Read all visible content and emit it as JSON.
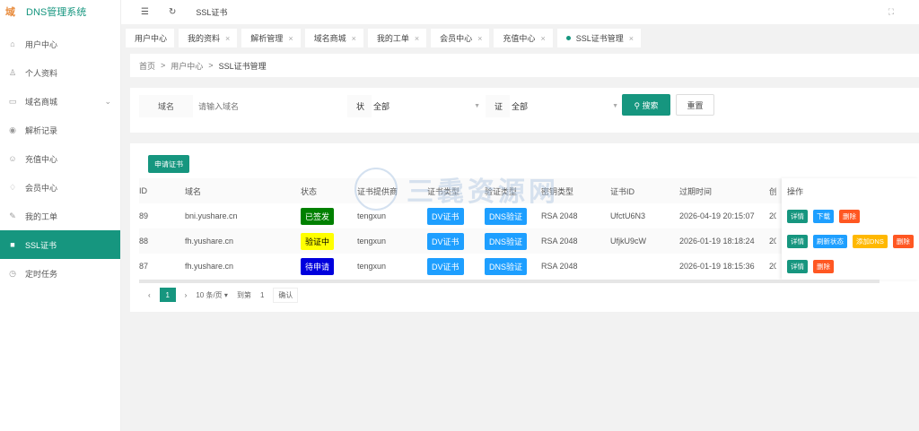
{
  "app": {
    "logo_glyph": "域",
    "title": "DNS管理系统"
  },
  "sidebar": {
    "items": [
      {
        "label": "用户中心",
        "icon": "home-icon",
        "glyph": "⌂"
      },
      {
        "label": "个人资料",
        "icon": "user-icon",
        "glyph": "♙"
      },
      {
        "label": "域名商城",
        "icon": "store-icon",
        "glyph": "▭",
        "has_children": true
      },
      {
        "label": "解析记录",
        "icon": "record-icon",
        "glyph": "◉"
      },
      {
        "label": "充值中心",
        "icon": "recharge-icon",
        "glyph": "☺"
      },
      {
        "label": "会员中心",
        "icon": "diamond-icon",
        "glyph": "♢"
      },
      {
        "label": "我的工单",
        "icon": "ticket-icon",
        "glyph": "✎"
      },
      {
        "label": "SSL证书",
        "icon": "ssl-icon",
        "glyph": "■",
        "active": true
      },
      {
        "label": "定时任务",
        "icon": "clock-icon",
        "glyph": "◷"
      }
    ]
  },
  "topbar": {
    "title": "SSL证书"
  },
  "tabs": [
    {
      "label": "用户中心",
      "closable": false
    },
    {
      "label": "我的资料",
      "closable": true
    },
    {
      "label": "解析管理",
      "closable": true
    },
    {
      "label": "域名商城",
      "closable": true
    },
    {
      "label": "我的工单",
      "closable": true
    },
    {
      "label": "会员中心",
      "closable": true
    },
    {
      "label": "充值中心",
      "closable": true
    },
    {
      "label": "SSL证书管理",
      "closable": true,
      "active": true
    }
  ],
  "breadcrumb": [
    "首页",
    "用户中心",
    "SSL证书管理"
  ],
  "breadcrumb_sep": ">",
  "filter": {
    "domain_label": "域名",
    "domain_placeholder": "请输入域名",
    "status_label": "状",
    "status_value": "全部",
    "type_label": "证",
    "type_value": "全部",
    "search_label": "搜索",
    "reset_label": "重置"
  },
  "table": {
    "apply_label": "申请证书",
    "headers": [
      "ID",
      "域名",
      "状态",
      "证书提供商",
      "证书类型",
      "验证类型",
      "密钥类型",
      "证书ID",
      "过期时间",
      "创",
      "操作"
    ],
    "rows": [
      {
        "id": "89",
        "domain": "bni.yushare.cn",
        "status": "已签发",
        "status_bg": "#008000",
        "status_fg": "#ffffff",
        "provider": "tengxun",
        "cert_type": "DV证书",
        "verify_type": "DNS验证",
        "key_type": "RSA 2048",
        "cert_id": "UfctU6N3",
        "expire": "2026-04-19 20:15:07",
        "created": "20",
        "actions": [
          {
            "label": "详情",
            "color": "#16967f"
          },
          {
            "label": "下载",
            "color": "#1e9fff"
          },
          {
            "label": "删除",
            "color": "#ff5722"
          }
        ]
      },
      {
        "id": "88",
        "domain": "fh.yushare.cn",
        "status": "验证中",
        "status_bg": "#ffff00",
        "status_fg": "#000000",
        "provider": "tengxun",
        "cert_type": "DV证书",
        "verify_type": "DNS验证",
        "key_type": "RSA 2048",
        "cert_id": "UfjkU9cW",
        "expire": "2026-01-19 18:18:24",
        "created": "20",
        "actions": [
          {
            "label": "详情",
            "color": "#16967f"
          },
          {
            "label": "刷新状态",
            "color": "#1e9fff"
          },
          {
            "label": "添加DNS",
            "color": "#ffb800"
          },
          {
            "label": "删除",
            "color": "#ff5722"
          }
        ]
      },
      {
        "id": "87",
        "domain": "fh.yushare.cn",
        "status": "待申请",
        "status_bg": "#0000dd",
        "status_fg": "#ffffff",
        "provider": "tengxun",
        "cert_type": "DV证书",
        "verify_type": "DNS验证",
        "key_type": "RSA 2048",
        "cert_id": "",
        "expire": "2026-01-19 18:15:36",
        "created": "20",
        "actions": [
          {
            "label": "详情",
            "color": "#16967f"
          },
          {
            "label": "删除",
            "color": "#ff5722"
          }
        ]
      }
    ]
  },
  "pagination": {
    "current": "1",
    "page_size": "10 条/页",
    "goto_label": "到第",
    "goto_value": "1",
    "confirm_label": "确认"
  },
  "watermark": "三毳资源网",
  "colors": {
    "primary": "#16967f",
    "info": "#1e9fff",
    "warn": "#ffb800",
    "danger": "#ff5722"
  }
}
